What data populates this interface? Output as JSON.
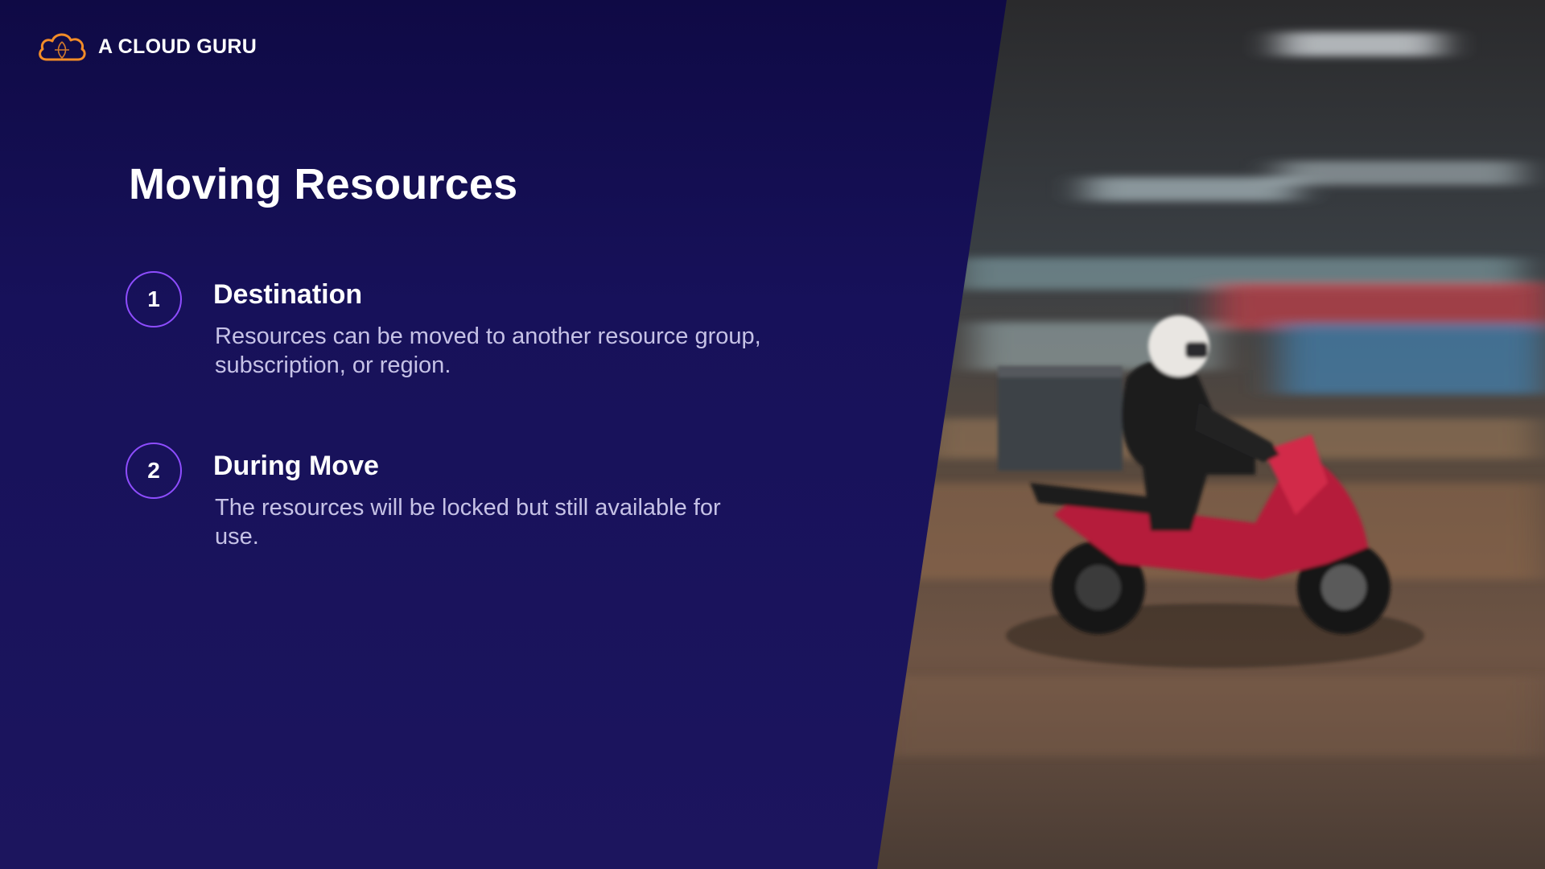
{
  "brand": {
    "logo_text": "A CLOUD GURU",
    "logo_icon": "cloud-icon",
    "logo_color": "#f28c28"
  },
  "slide": {
    "title": "Moving Resources",
    "accent_color": "#8e4dff",
    "items": [
      {
        "number": "1",
        "heading": "Destination",
        "description": "Resources can be moved to another resource group, subscription, or region."
      },
      {
        "number": "2",
        "heading": "During Move",
        "description": "The resources will be locked but still available for use."
      }
    ]
  },
  "photo": {
    "subject": "motion-blurred delivery scooter rider at night"
  }
}
